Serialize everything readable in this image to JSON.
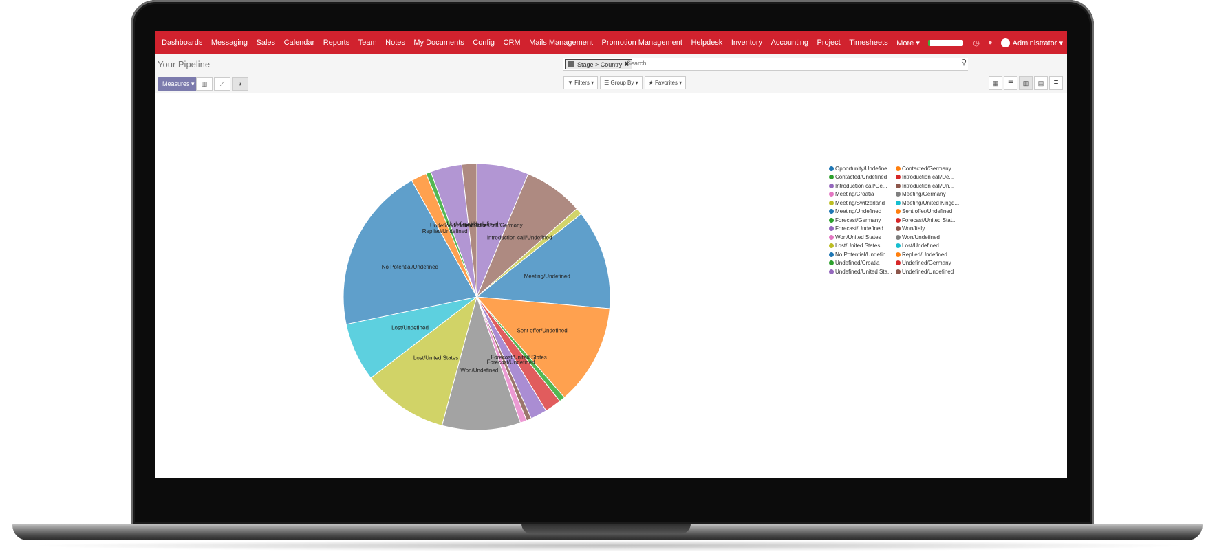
{
  "nav": {
    "menu": [
      "Dashboards",
      "Messaging",
      "Sales",
      "Calendar",
      "Reports",
      "Team",
      "Notes",
      "My Documents",
      "Config",
      "CRM",
      "Mails Management",
      "Promotion Management",
      "Helpdesk",
      "Inventory",
      "Accounting",
      "Project",
      "Timesheets",
      "More ▾"
    ],
    "user": "Administrator ▾"
  },
  "control": {
    "title": "Your Pipeline",
    "measures": "Measures ▾",
    "facet": "Stage > Country",
    "search_placeholder": "Search...",
    "filters": "▼ Filters ▾",
    "groupby": "☰ Group By ▾",
    "favorites": "★ Favorites ▾"
  },
  "legend": [
    {
      "label": "Opportunity/Undefine...",
      "color": "#1f77b4"
    },
    {
      "label": "Contacted/Germany",
      "color": "#ff7f0e"
    },
    {
      "label": "Contacted/Undefined",
      "color": "#2ca02c"
    },
    {
      "label": "Introduction call/De...",
      "color": "#d62728"
    },
    {
      "label": "Introduction call/Ge...",
      "color": "#9467bd"
    },
    {
      "label": "Introduction call/Un...",
      "color": "#8c564b"
    },
    {
      "label": "Meeting/Croatia",
      "color": "#e377c2"
    },
    {
      "label": "Meeting/Germany",
      "color": "#7f7f7f"
    },
    {
      "label": "Meeting/Switzerland",
      "color": "#bcbd22"
    },
    {
      "label": "Meeting/United Kingd...",
      "color": "#17becf"
    },
    {
      "label": "Meeting/Undefined",
      "color": "#1f77b4"
    },
    {
      "label": "Sent offer/Undefined",
      "color": "#ff7f0e"
    },
    {
      "label": "Forecast/Germany",
      "color": "#2ca02c"
    },
    {
      "label": "Forecast/United Stat...",
      "color": "#d62728"
    },
    {
      "label": "Forecast/Undefined",
      "color": "#9467bd"
    },
    {
      "label": "Won/Italy",
      "color": "#8c564b"
    },
    {
      "label": "Won/United States",
      "color": "#e377c2"
    },
    {
      "label": "Won/Undefined",
      "color": "#7f7f7f"
    },
    {
      "label": "Lost/United States",
      "color": "#bcbd22"
    },
    {
      "label": "Lost/Undefined",
      "color": "#17becf"
    },
    {
      "label": "No Potential/Undefin...",
      "color": "#1f77b4"
    },
    {
      "label": "Replied/Undefined",
      "color": "#ff7f0e"
    },
    {
      "label": "Undefined/Croatia",
      "color": "#2ca02c"
    },
    {
      "label": "Undefined/Germany",
      "color": "#d62728"
    },
    {
      "label": "Undefined/United Sta...",
      "color": "#9467bd"
    },
    {
      "label": "Undefined/Undefined",
      "color": "#8c564b"
    }
  ],
  "chart_data": {
    "type": "pie",
    "slices": [
      {
        "label": "Introduction call/Germany",
        "value": 6.3,
        "color": "#b296d3"
      },
      {
        "label": "Introduction call/Undefined",
        "value": 7.2,
        "color": "#ae8a81"
      },
      {
        "label": "",
        "value": 0.8,
        "color": "#d2d46a"
      },
      {
        "label": "Meeting/Undefined",
        "value": 12.1,
        "color": "#5f9fcb"
      },
      {
        "label": "Sent offer/Undefined",
        "value": 12.2,
        "color": "#ffa14f"
      },
      {
        "label": "",
        "value": 0.7,
        "color": "#53b753"
      },
      {
        "label": "Forecast/United States",
        "value": 2.0,
        "color": "#e15c5d"
      },
      {
        "label": "Forecast/Undefined",
        "value": 2.0,
        "color": "#aa8dd3"
      },
      {
        "label": "",
        "value": 0.6,
        "color": "#9b766c"
      },
      {
        "label": "",
        "value": 0.8,
        "color": "#ec9ad3"
      },
      {
        "label": "Won/Undefined",
        "value": 9.5,
        "color": "#a3a3a3"
      },
      {
        "label": "Lost/United States",
        "value": 10.4,
        "color": "#d1d367"
      },
      {
        "label": "Lost/Undefined",
        "value": 7.1,
        "color": "#5dd0df"
      },
      {
        "label": "No Potential/Undefined",
        "value": 20.2,
        "color": "#5f9fcb"
      },
      {
        "label": "Replied/Undefined",
        "value": 1.9,
        "color": "#ffa14f"
      },
      {
        "label": "",
        "value": 0.6,
        "color": "#53b753"
      },
      {
        "label": "Undefined/United States",
        "value": 3.8,
        "color": "#b296d3"
      },
      {
        "label": "Undefined/Undefined",
        "value": 1.8,
        "color": "#ae8a81"
      }
    ]
  }
}
